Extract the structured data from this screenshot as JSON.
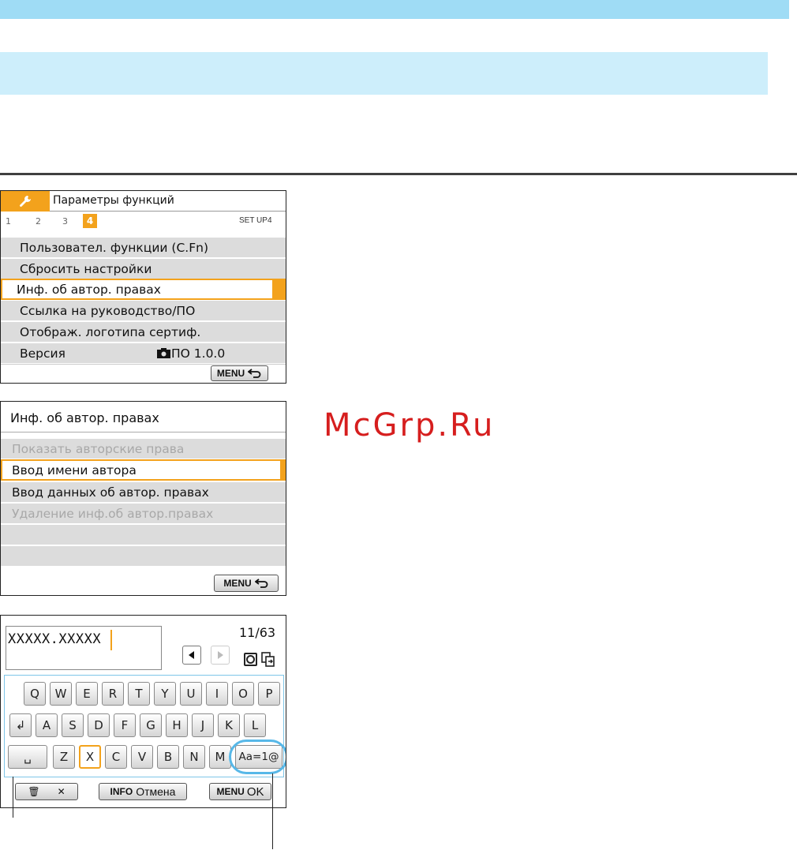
{
  "screen1": {
    "header_title": "Параметры функций",
    "tabs": [
      "1",
      "2",
      "3",
      "4"
    ],
    "active_tab": "4",
    "tab_code": "SET UP4",
    "items": [
      {
        "label": "Пользовател. функции (C.Fn)",
        "value": ""
      },
      {
        "label": "Сбросить настройки",
        "value": ""
      },
      {
        "label": "Инф. об автор. правах",
        "value": ""
      },
      {
        "label": "Ссылка на руководство/ПО",
        "value": ""
      },
      {
        "label": "Отображ. логотипа сертиф.",
        "value": ""
      },
      {
        "label": "Версия",
        "value": "ПО 1.0.0"
      }
    ],
    "selected_index": 2,
    "menu_button": "MENU",
    "accent_color": "#f3a21c"
  },
  "screen2": {
    "header_title": "Инф. об автор. правах",
    "items": [
      {
        "label": "Показать авторские права",
        "disabled": true
      },
      {
        "label": "Ввод имени автора",
        "disabled": false
      },
      {
        "label": "Ввод данных об автор. правах",
        "disabled": false
      },
      {
        "label": "Удаление инф.об автор.правах",
        "disabled": true
      }
    ],
    "selected_index": 1,
    "menu_button": "MENU"
  },
  "screen3": {
    "input_value": "XXXXX.XXXXX",
    "char_count": "11/63",
    "rows": [
      [
        "Q",
        "W",
        "E",
        "R",
        "T",
        "Y",
        "U",
        "I",
        "O",
        "P"
      ],
      [
        "↲",
        "A",
        "S",
        "D",
        "F",
        "G",
        "H",
        "J",
        "K",
        "L"
      ],
      [
        "␣",
        "Z",
        "X",
        "C",
        "V",
        "B",
        "N",
        "M",
        "Aa=1@"
      ]
    ],
    "active_key": "X",
    "delete_label": "🗑",
    "delete_x": "✕",
    "info_label": "INFO",
    "cancel_label": "Отмена",
    "menu_label": "MENU",
    "ok_label": "OK"
  },
  "watermark": "McGrp.Ru"
}
